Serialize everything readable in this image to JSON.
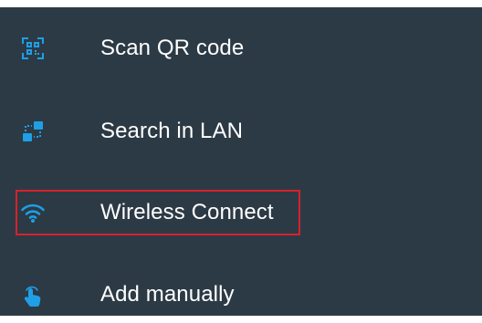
{
  "menu": {
    "items": [
      {
        "label": "Scan QR code",
        "icon": "qr-code-icon"
      },
      {
        "label": "Search in LAN",
        "icon": "lan-devices-icon"
      },
      {
        "label": "Wireless Connect",
        "icon": "wifi-icon"
      },
      {
        "label": "Add manually",
        "icon": "hand-pointer-icon"
      }
    ],
    "highlighted_index": 2
  },
  "colors": {
    "background": "#2c3a45",
    "icon_accent": "#1e9fe6",
    "text": "#ffffff",
    "highlight_border": "#d8212b"
  }
}
